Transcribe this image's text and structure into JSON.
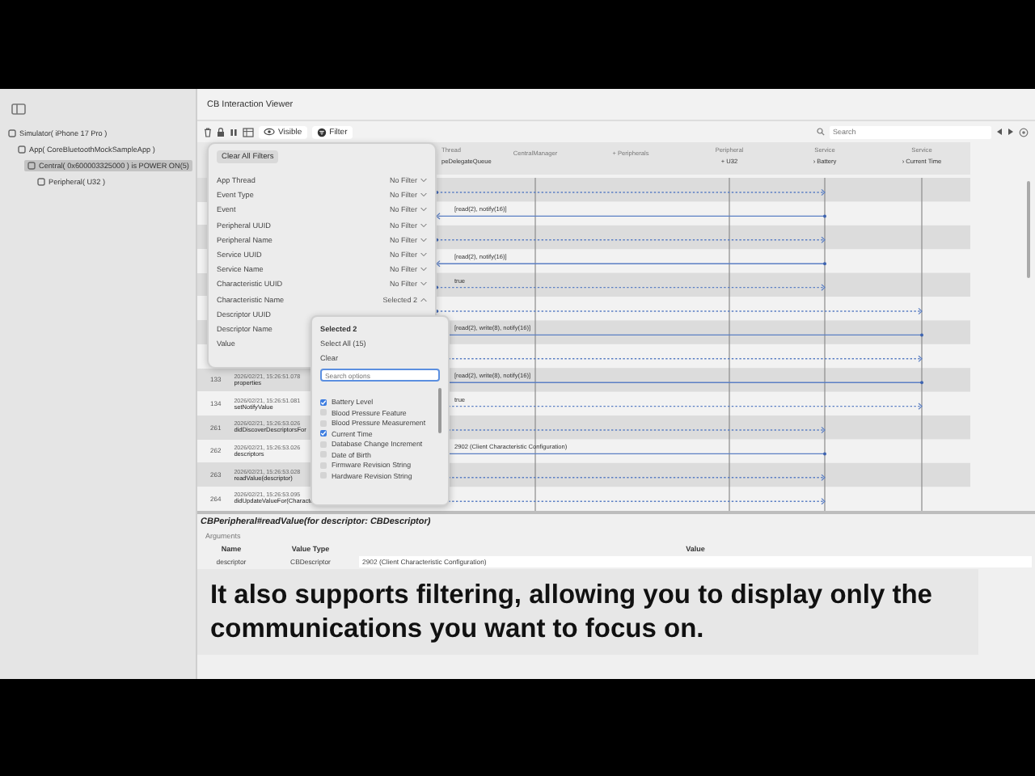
{
  "window": {
    "title": "CB Interaction Viewer"
  },
  "sidebar": {
    "items": [
      {
        "label": "Simulator( iPhone 17 Pro )",
        "selected": false,
        "children": [
          {
            "label": "App( CoreBluetoothMockSampleApp )",
            "selected": false,
            "children": [
              {
                "label": "Central( 0x600003325000 ) is POWER ON(5)",
                "selected": true,
                "children": [
                  {
                    "label": "Peripheral( U32 )",
                    "selected": false
                  }
                ]
              }
            ]
          }
        ]
      }
    ]
  },
  "toolbar": {
    "visible_button": "Visible",
    "filter_button": "Filter",
    "search": {
      "placeholder": "Search"
    }
  },
  "diagram": {
    "columns": [
      {
        "kind": "lifeline",
        "title": "Thread",
        "subtitle": "peDelegateQueue"
      },
      {
        "kind": "lifeline",
        "title": "CentralManager"
      },
      {
        "kind": "group",
        "title": "+ Peripherals"
      },
      {
        "kind": "lifeline",
        "title": "Peripheral",
        "subtitle": "+ U32"
      },
      {
        "kind": "lifeline",
        "title": "Service",
        "subtitle": "› Battery"
      },
      {
        "kind": "lifeline",
        "title": "Service",
        "subtitle": "› Current Time"
      }
    ],
    "messages": [
      {
        "kind": "call"
      },
      {
        "kind": "return",
        "label": "[read(2), notify(16)]"
      },
      {
        "kind": "call"
      },
      {
        "kind": "return",
        "label": "[read(2), notify(16)]"
      },
      {
        "kind": "call",
        "label": "true"
      },
      {
        "kind": "call"
      },
      {
        "kind": "return",
        "label": "[read(2), write(8), notify(16)]"
      },
      {
        "kind": "call"
      },
      {
        "kind": "return",
        "label": "[read(2), write(8), notify(16)]",
        "event": {
          "number": "133",
          "time": "2026/02/21, 15:26:51.078",
          "name": "properties"
        }
      },
      {
        "kind": "call",
        "label": "true",
        "event": {
          "number": "134",
          "time": "2026/02/21, 15:26:51.081",
          "name": "setNotifyValue"
        }
      },
      {
        "kind": "call",
        "event": {
          "number": "261",
          "time": "2026/02/21, 15:26:53.026",
          "name": "didDiscoverDescriptorsFor"
        }
      },
      {
        "kind": "return",
        "label": "2902 (Client Characteristic Configuration)",
        "event": {
          "number": "262",
          "time": "2026/02/21, 15:26:53.026",
          "name": "descriptors"
        }
      },
      {
        "kind": "call",
        "event": {
          "number": "263",
          "time": "2026/02/21, 15:26:53.028",
          "name": "readValue(descriptor)"
        }
      },
      {
        "kind": "call",
        "event": {
          "number": "264",
          "time": "2026/02/21, 15:26:53.095",
          "name": "didUpdateValueFor(Characte"
        }
      }
    ]
  },
  "filter": {
    "clear_button": "Clear All Filters",
    "rows": [
      {
        "label": "App Thread",
        "value": "No Filter",
        "expanded": false
      },
      {
        "label": "Event Type",
        "value": "No Filter",
        "expanded": false
      },
      {
        "label": "Event",
        "value": "No Filter",
        "expanded": false
      },
      {
        "label": "Peripheral UUID",
        "value": "No Filter",
        "expanded": false
      },
      {
        "label": "Peripheral Name",
        "value": "No Filter",
        "expanded": false
      },
      {
        "label": "Service UUID",
        "value": "No Filter",
        "expanded": false
      },
      {
        "label": "Service Name",
        "value": "No Filter",
        "expanded": false
      },
      {
        "label": "Characteristic UUID",
        "value": "No Filter",
        "expanded": false
      },
      {
        "label": "Characteristic Name",
        "value": "Selected 2",
        "expanded": true
      },
      {
        "label": "Descriptor UUID"
      },
      {
        "label": "Descriptor Name"
      },
      {
        "label": "Value"
      }
    ]
  },
  "options_popup": {
    "title": "Selected 2",
    "select_all": "Select All (15)",
    "clear": "Clear",
    "search": {
      "placeholder": "Search options"
    },
    "options": [
      {
        "label": "Battery Level",
        "checked": true
      },
      {
        "label": "Blood Pressure Feature",
        "checked": false
      },
      {
        "label": "Blood Pressure Measurement",
        "checked": false
      },
      {
        "label": "Current Time",
        "checked": true
      },
      {
        "label": "Database Change Increment",
        "checked": false
      },
      {
        "label": "Date of Birth",
        "checked": false
      },
      {
        "label": "Firmware Revision String",
        "checked": false
      },
      {
        "label": "Hardware Revision String",
        "checked": false
      }
    ]
  },
  "detail": {
    "title": "CBPeripheral#readValue(for descriptor: CBDescriptor)",
    "section": "Arguments",
    "columns": [
      "Name",
      "Value Type",
      "Value"
    ],
    "rows": [
      [
        "descriptor",
        "CBDescriptor",
        "2902 (Client Characteristic Configuration)"
      ]
    ]
  },
  "caption": {
    "text": "It also supports filtering, allowing you to display only the communications you want to focus on."
  }
}
